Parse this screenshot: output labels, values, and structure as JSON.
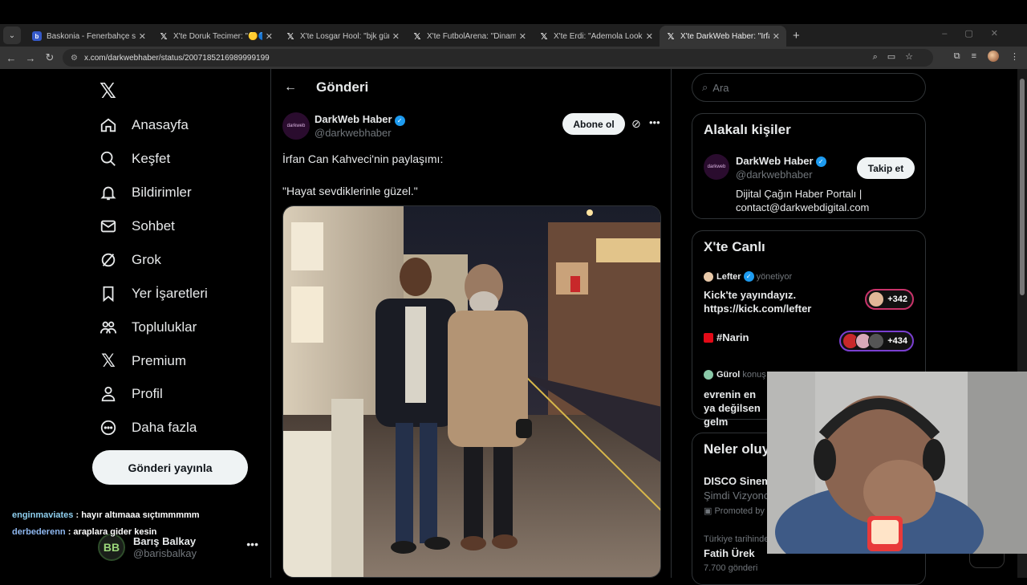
{
  "browser": {
    "tabs": [
      {
        "title": "Baskonia - Fenerbahçe skorlar",
        "icon": "b-icon",
        "active": false
      },
      {
        "title": "X'te Doruk Tecimer: \"🟡🔵 Fene",
        "icon": "x-icon",
        "active": false
      },
      {
        "title": "X'te Losgar Hool: \"bjk gündemi",
        "icon": "x-icon",
        "active": false
      },
      {
        "title": "X'te FutbolArena: \"Dinamo Zagr",
        "icon": "x-icon",
        "active": false
      },
      {
        "title": "X'te Erdi: \"Ademola Lookman🇳🇬",
        "icon": "x-icon",
        "active": false
      },
      {
        "title": "X'te DarkWeb Haber: \"İrfan Can",
        "icon": "x-icon",
        "active": true
      }
    ],
    "url": "x.com/darkwebhaber/status/2007185216989999199"
  },
  "sidebar": {
    "nav": [
      {
        "label": "Anasayfa",
        "icon": "home-icon"
      },
      {
        "label": "Keşfet",
        "icon": "search-icon"
      },
      {
        "label": "Bildirimler",
        "icon": "bell-icon"
      },
      {
        "label": "Sohbet",
        "icon": "mail-icon"
      },
      {
        "label": "Grok",
        "icon": "grok-icon"
      },
      {
        "label": "Yer İşaretleri",
        "icon": "bookmark-icon"
      },
      {
        "label": "Topluluklar",
        "icon": "communities-icon"
      },
      {
        "label": "Premium",
        "icon": "x-icon"
      },
      {
        "label": "Profil",
        "icon": "profile-icon"
      },
      {
        "label": "Daha fazla",
        "icon": "more-circle-icon"
      }
    ],
    "post_button": "Gönderi yayınla",
    "account": {
      "name": "Barış Balkay",
      "handle": "@barisbalkay",
      "initials": "BB"
    }
  },
  "chat_overlay": [
    {
      "user": "enginmaviates",
      "message": " : hayır altımaaa sıçtımmmmm"
    },
    {
      "user": "derbederenn",
      "message": " : araplara gider kesin"
    }
  ],
  "main": {
    "header_title": "Gönderi",
    "author": {
      "name": "DarkWeb Haber",
      "handle": "@darkwebhaber",
      "avatar_text": "darkweb"
    },
    "follow_label": "Abone ol",
    "text_lines": [
      "İrfan Can Kahveci'nin paylaşımı:",
      "\"Hayat sevdiklerinle güzel.\""
    ]
  },
  "right": {
    "search_placeholder": "Ara",
    "related": {
      "heading": "Alakalı kişiler",
      "name": "DarkWeb Haber",
      "handle": "@darkwebhaber",
      "follow_label": "Takip et",
      "bio": "Dijital Çağın Haber Portalı | contact@darkwebdigital.com"
    },
    "live": {
      "heading": "X'te Canlı",
      "items": [
        {
          "host": "Lefter",
          "role": "yönetiyor",
          "title": "Kick'te yayındayız. https://kick.com/lefter",
          "count": "+342"
        },
        {
          "host": "#Narin",
          "role": "",
          "title": "",
          "count": "+434"
        },
        {
          "host": "Gürol",
          "role": "konuş",
          "title": "evrenin en ya değilsen gelm",
          "count": ""
        }
      ]
    },
    "news": {
      "heading": "Neler oluy",
      "items": [
        {
          "title": "DISCO Sinem",
          "sub": "Şimdi Vizyonc",
          "meta": "Promoted by"
        },
        {
          "meta_top": "Türkiye tarihinde",
          "title": "Fatih Ürek",
          "sub": "7.700 gönderi"
        }
      ]
    }
  },
  "colors": {
    "accent": "#1d9bf0",
    "border": "#2f3336",
    "muted": "#71767b",
    "text": "#e7e9ea"
  }
}
